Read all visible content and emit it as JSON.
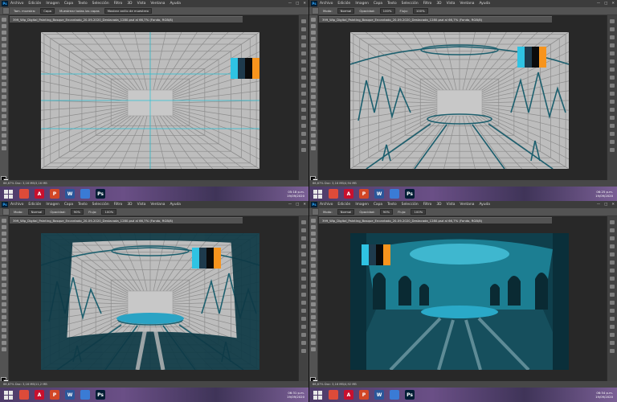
{
  "app": {
    "menu": [
      "Archivo",
      "Edición",
      "Imagen",
      "Capa",
      "Texto",
      "Selección",
      "Filtro",
      "3D",
      "Vista",
      "Ventana",
      "Ayuda"
    ],
    "document_tab": "399_Wip_Digital_Painting_Bosque_Encantado_20-09-2020_Destacada_1280.psd al 66,7% (Fondo, RGB/8)",
    "window_controls": [
      "—",
      "□",
      "✕"
    ],
    "palette": [
      "#2fc3e3",
      "#1e3a4c",
      "#0b0b0b",
      "#f7941d"
    ]
  },
  "quadrants": [
    {
      "options": {
        "items": [
          "Tam. muestra:",
          "Capa",
          "Muestrear todas las capas",
          "Mostrar anillo de muestreo"
        ]
      },
      "status": "66,67%   Doc: 3,16 MB/3,16 MB",
      "clock": {
        "time": "05:18 p.m.",
        "date": "19/09/2020"
      }
    },
    {
      "options": {
        "items": [
          "Modo:",
          "Normal",
          "Opacidad:",
          "100%",
          "Flujo:",
          "100%"
        ]
      },
      "status": "66,67%   Doc: 3,16 MB/4,94 MB",
      "clock": {
        "time": "06:25 p.m.",
        "date": "19/09/2020"
      }
    },
    {
      "options": {
        "items": [
          "Modo:",
          "Normal",
          "Opacidad:",
          "90%",
          "Flujo:",
          "100%"
        ]
      },
      "status": "66,67%   Doc: 3,16 MB/11,2 MB",
      "clock": {
        "time": "06:31 p.m.",
        "date": "19/09/2020"
      }
    },
    {
      "options": {
        "items": [
          "Modo:",
          "Normal",
          "Opacidad:",
          "90%",
          "Flujo:",
          "100%"
        ]
      },
      "status": "66,67%   Doc: 3,16 MB/4,92 MB",
      "clock": {
        "time": "06:54 p.m.",
        "date": "19/09/2020"
      }
    }
  ],
  "taskbar": {
    "apps": [
      {
        "icon": "chrome-icon",
        "color": "#dd4b39",
        "label": ""
      },
      {
        "icon": "acrobat-icon",
        "color": "#c8102e",
        "label": "A"
      },
      {
        "icon": "powerpoint-icon",
        "color": "#d24726",
        "label": "P"
      },
      {
        "icon": "word-icon",
        "color": "#2b579a",
        "label": "W"
      },
      {
        "icon": "screen-icon",
        "color": "#3a7bd5",
        "label": ""
      },
      {
        "icon": "photoshop-icon",
        "color": "#001d34",
        "label": "Ps"
      }
    ]
  }
}
